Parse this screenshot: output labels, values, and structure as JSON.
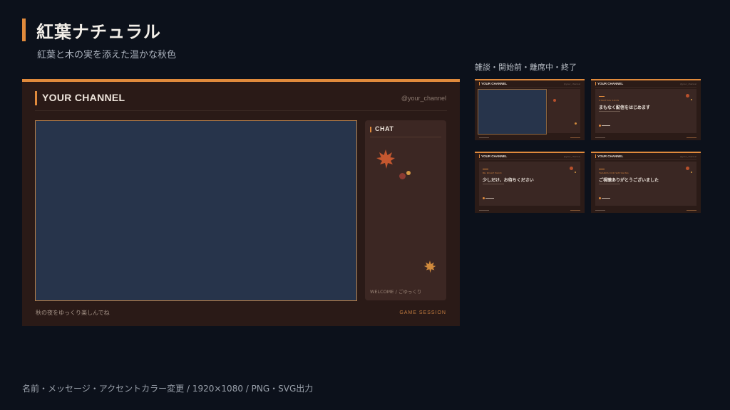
{
  "header": {
    "title": "紅葉ナチュラル",
    "subtitle": "紅葉と木の実を添えた温かな秋色"
  },
  "preview": {
    "channel_name": "YOUR CHANNEL",
    "handle": "@your_channel",
    "chat_title": "CHAT",
    "chat_welcome": "WELCOME / ごゆっくり",
    "caption": "秋の夜をゆっくり楽しんでね",
    "session": "GAME SESSION"
  },
  "thumbnails": {
    "label": "雑談・開始前・離席中・終了",
    "items": [
      {
        "channel": "YOUR CHANNEL",
        "handle": "@your_channel",
        "kind": "chat"
      },
      {
        "channel": "YOUR CHANNEL",
        "handle": "@your_channel",
        "kind": "card",
        "tag": "STARTING SOON",
        "message": "まもなく配信をはじめます"
      },
      {
        "channel": "YOUR CHANNEL",
        "handle": "@your_channel",
        "kind": "card",
        "tag": "BE RIGHT BACK",
        "message": "少しだけ、お待ちください"
      },
      {
        "channel": "YOUR CHANNEL",
        "handle": "@your_channel",
        "kind": "card",
        "tag": "THANKS FOR WATCHING",
        "message": "ご視聴ありがとうございました"
      }
    ]
  },
  "footer": "名前・メッセージ・アクセントカラー変更 / 1920×1080 / PNG・SVG出力",
  "colors": {
    "accent": "#e08a3c",
    "background": "#0c111b",
    "panel": "#2a1a17",
    "video": "#27344b"
  },
  "icons": [
    "maple-leaf-icon",
    "berry-icon"
  ]
}
